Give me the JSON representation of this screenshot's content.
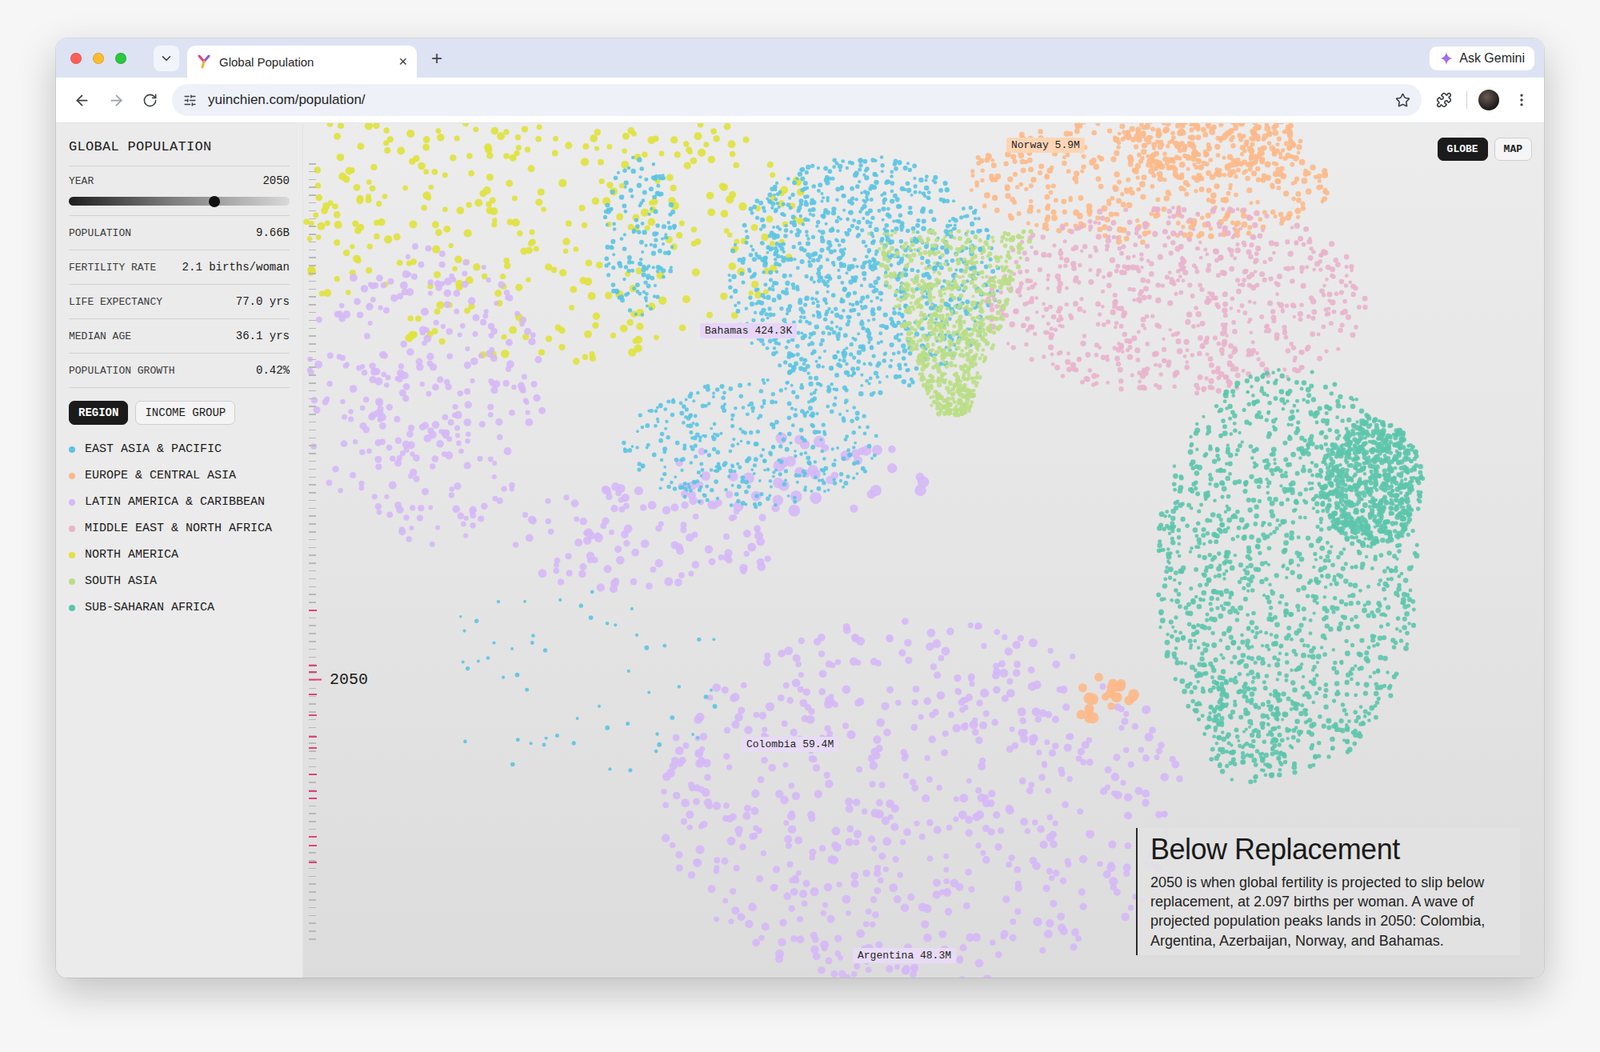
{
  "window": {
    "title": "Global Population",
    "close": "×",
    "new_tab": "+",
    "ask": "Ask Gemini"
  },
  "address_bar": {
    "url": "yuinchien.com/population/"
  },
  "sidebar": {
    "title": "GLOBAL POPULATION",
    "year": {
      "label": "YEAR",
      "value": "2050",
      "level": 0.66
    },
    "stats": [
      {
        "label": "POPULATION",
        "value": "9.66B"
      },
      {
        "label": "FERTILITY RATE",
        "value": "2.1 births/woman"
      },
      {
        "label": "LIFE EXPECTANCY",
        "value": "77.0 yrs"
      },
      {
        "label": "MEDIAN AGE",
        "value": "36.1 yrs"
      },
      {
        "label": "POPULATION GROWTH",
        "value": "0.42%"
      }
    ],
    "groupings": [
      {
        "label": "REGION",
        "selected": true
      },
      {
        "label": "INCOME GROUP",
        "selected": false
      }
    ],
    "legend": [
      {
        "name": "EAST ASIA & PACIFIC",
        "color": "#5bc4e2"
      },
      {
        "name": "EUROPE & CENTRAL ASIA",
        "color": "#fdb98a"
      },
      {
        "name": "LATIN AMERICA & CARIBBEAN",
        "color": "#d5b8f6"
      },
      {
        "name": "MIDDLE EAST & NORTH AFRICA",
        "color": "#e9b3cc"
      },
      {
        "name": "NORTH AMERICA",
        "color": "#dfe23a"
      },
      {
        "name": "SOUTH ASIA",
        "color": "#bade86"
      },
      {
        "name": "SUB-SAHARAN AFRICA",
        "color": "#5cc5ac"
      }
    ]
  },
  "view_modes": [
    {
      "label": "GLOBE",
      "selected": true
    },
    {
      "label": "MAP",
      "selected": false
    }
  ],
  "timeline": {
    "label": "2050",
    "level": 0.666,
    "marks": [
      0.576,
      0.647,
      0.655,
      0.684,
      0.711,
      0.739,
      0.753,
      0.787,
      0.809,
      0.818,
      0.868,
      0.879,
      0.901
    ]
  },
  "labels": [
    {
      "text": "Norway 5.9M",
      "color": "#fdd5b5"
    },
    {
      "text": "Bahamas 424.3K",
      "color": "#e6d5f7"
    },
    {
      "text": "Colombia 59.4M",
      "color": "#e8dbf6"
    },
    {
      "text": "Argentina 48.3M",
      "color": "#e8dbf6"
    }
  ],
  "story": {
    "title": "Below Replacement",
    "body": "2050 is when global fertility is projected to slip below replacement, at 2.097 births per woman. A wave of projected population peaks lands in 2050: Colombia, Argentina, Azerbaijan, Norway, and Bahamas."
  }
}
